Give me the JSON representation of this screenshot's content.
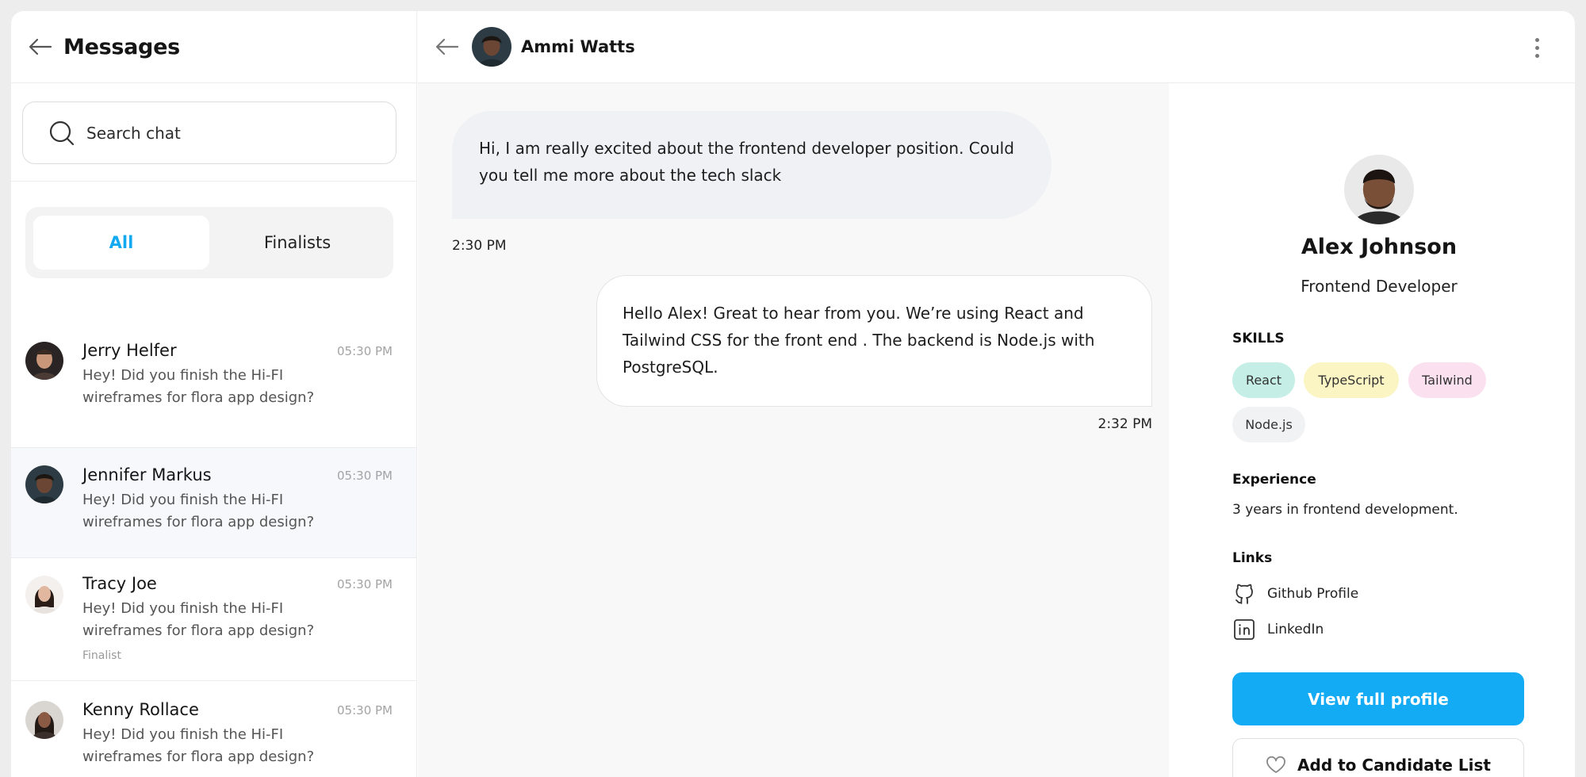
{
  "sidebar": {
    "title": "Messages",
    "search": {
      "placeholder": "Search chat"
    },
    "tabs": [
      {
        "label": "All",
        "active": true
      },
      {
        "label": "Finalists",
        "active": false
      }
    ],
    "chats": [
      {
        "name": "Jerry Helfer",
        "time": "05:30 PM",
        "preview": "Hey! Did you finish the Hi-FI wireframes for flora app design?",
        "badge": ""
      },
      {
        "name": "Jennifer Markus",
        "time": "05:30 PM",
        "preview": "Hey! Did you finish the Hi-FI wireframes for flora app design?",
        "badge": ""
      },
      {
        "name": "Tracy Joe",
        "time": "05:30 PM",
        "preview": "Hey! Did you finish the Hi-FI wireframes for flora app design?",
        "badge": "Finalist"
      },
      {
        "name": "Kenny Rollace",
        "time": "05:30 PM",
        "preview": "Hey! Did you finish the Hi-FI wireframes for flora app design?",
        "badge": ""
      }
    ]
  },
  "conversation": {
    "contact_name": "Ammi Watts",
    "messages": [
      {
        "direction": "incoming",
        "text": "Hi, I am really excited about the frontend developer position. Could you tell me more about the tech  slack",
        "time": "2:30 PM"
      },
      {
        "direction": "outgoing",
        "text": "Hello Alex! Great to hear from you. We’re using  React and Tailwind CSS for the front end . The backend is Node.js  with PostgreSQL.",
        "time": "2:32 PM"
      }
    ]
  },
  "profile": {
    "name": "Alex Johnson",
    "role": "Frontend Developer",
    "skills_title": "SKILLS",
    "skills": [
      {
        "label": "React",
        "color": "#c5efe6"
      },
      {
        "label": "TypeScript",
        "color": "#fbf4c3"
      },
      {
        "label": "Tailwind",
        "color": "#fbe0f0"
      },
      {
        "label": "Node.js",
        "color": "#f1f2f4"
      }
    ],
    "experience_title": "Experience",
    "experience_text": "3 years in frontend development.",
    "links_title": "Links",
    "links": [
      {
        "label": "Github Profile",
        "icon": "github-icon"
      },
      {
        "label": "LinkedIn",
        "icon": "linkedin-icon"
      }
    ],
    "primary_button": "View full profile",
    "secondary_button": "Add to Candidate List"
  },
  "colors": {
    "accent": "#14abf5",
    "active_tab_text": "#12a9f0",
    "incoming_bubble": "#eff1f4",
    "chat_background": "#f8f8f8"
  }
}
